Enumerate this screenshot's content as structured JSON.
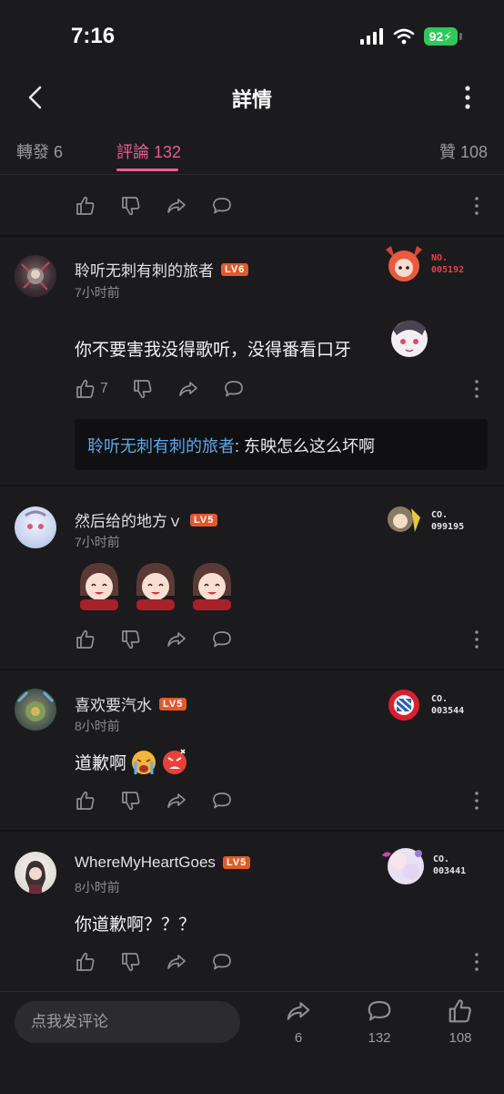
{
  "status": {
    "time": "7:16",
    "battery": "92"
  },
  "header": {
    "title": "詳情"
  },
  "tabs": {
    "repost": "轉發 6",
    "comments": "評論 132",
    "likes": "贊 108"
  },
  "top_row": {
    "like_count": ""
  },
  "comments": [
    {
      "username": "聆听无刺有刺的旅者",
      "level": "LV6",
      "time": "7小时前",
      "text": "你不要害我没得歌听，没得番看口牙",
      "like_count": "7",
      "badge": [
        "NO.",
        "005192"
      ],
      "reply_name": "聆听无刺有刺的旅者",
      "reply_text": ": 东映怎么这么坏啊"
    },
    {
      "username": "然后给的地方ｖ",
      "level": "LV5",
      "time": "7小时前",
      "text": "",
      "like_count": "",
      "badge": [
        "CO.",
        "099195"
      ]
    },
    {
      "username": "喜欢要汽水",
      "level": "LV5",
      "time": "8小时前",
      "text": "道歉啊",
      "like_count": "",
      "badge": [
        "CO.",
        "003544"
      ]
    },
    {
      "username": "WhereMyHeartGoes",
      "level": "LV5",
      "time": "8小时前",
      "text": "你道歉啊？？？",
      "like_count": "",
      "badge": [
        "CO.",
        "003441"
      ]
    }
  ],
  "bottom": {
    "input_placeholder": "点我发评论",
    "repost_count": "6",
    "comment_count": "132",
    "like_count": "108"
  },
  "colors": {
    "accent": "#ee5c8c",
    "link": "#5fa7e8",
    "level": "#e05a2a"
  }
}
